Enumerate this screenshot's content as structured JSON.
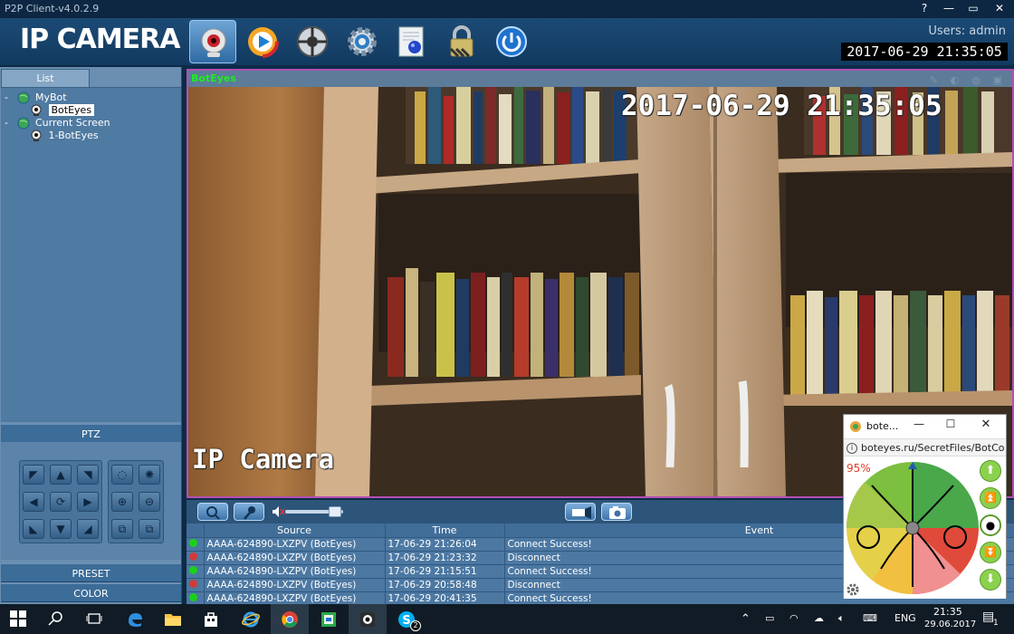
{
  "app": {
    "title": "P2P Client-v4.0.2.9",
    "brand": "IP CAMERA",
    "users": "Users: admin",
    "clock": "2017-06-29  21:35:05",
    "window_controls": [
      "?",
      "—",
      "▭",
      "✕"
    ]
  },
  "toolbar": {
    "items": [
      {
        "name": "camera-view-icon",
        "active": true
      },
      {
        "name": "playback-icon",
        "active": false
      },
      {
        "name": "ptz-settings-icon",
        "active": false
      },
      {
        "name": "settings-gear-icon",
        "active": false
      },
      {
        "name": "log-map-icon",
        "active": false
      },
      {
        "name": "lock-icon",
        "active": false
      },
      {
        "name": "power-icon",
        "active": false
      }
    ]
  },
  "left": {
    "list_tab": "List",
    "tree": [
      {
        "expander": "-",
        "label": "MyBot"
      },
      {
        "label": "BotEyes",
        "selected": true
      },
      {
        "expander": "-",
        "label": "Current Screen"
      },
      {
        "label": "1-BotEyes"
      }
    ],
    "ptz_label": "PTZ",
    "preset_label": "PRESET",
    "color_label": "COLOR"
  },
  "video": {
    "channel_title": "BotEyes",
    "osd_datetime": "2017-06-29  21:35:05",
    "osd_label": "IP Camera"
  },
  "eventlog": {
    "headers": {
      "source": "Source",
      "time": "Time",
      "event": "Event"
    },
    "rows": [
      {
        "status": "ok",
        "source": "AAAA-624890-LXZPV (BotEyes)",
        "time": "17-06-29 21:26:04",
        "event": "Connect Success!"
      },
      {
        "status": "fail",
        "source": "AAAA-624890-LXZPV (BotEyes)",
        "time": "17-06-29 21:23:32",
        "event": "Disconnect"
      },
      {
        "status": "ok",
        "source": "AAAA-624890-LXZPV (BotEyes)",
        "time": "17-06-29 21:15:51",
        "event": "Connect Success!"
      },
      {
        "status": "fail",
        "source": "AAAA-624890-LXZPV (BotEyes)",
        "time": "17-06-29 20:58:48",
        "event": "Disconnect"
      },
      {
        "status": "ok",
        "source": "AAAA-624890-LXZPV (BotEyes)",
        "time": "17-06-29 20:41:35",
        "event": "Connect Success!"
      }
    ]
  },
  "popup": {
    "title": "bote...",
    "url": "boteyes.ru/SecretFiles/BotCo",
    "battery": "95%"
  },
  "taskbar": {
    "lang": "ENG",
    "time": "21:35",
    "date": "29.06.2017",
    "skype_badge": "2",
    "notif_count": "1"
  },
  "colors": {
    "video_border": "#b24fb6",
    "channel_title": "#1bef1b",
    "status_ok": "#1ad11a",
    "status_fail": "#d23a3a"
  }
}
